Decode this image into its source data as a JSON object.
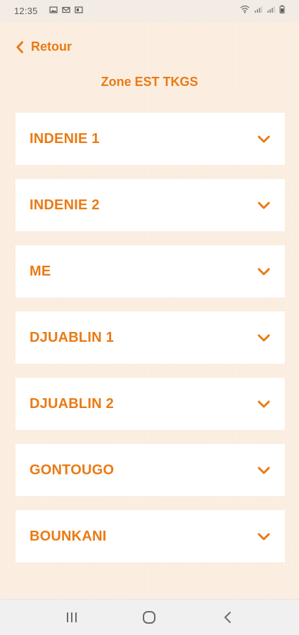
{
  "status_bar": {
    "time": "12:35",
    "left_icons": [
      "image-icon",
      "mail-icon",
      "media-icon"
    ],
    "right_icons": [
      "wifi-icon",
      "signal-icon",
      "signal-icon",
      "battery-icon"
    ]
  },
  "header": {
    "back_label": "Retour",
    "title": "Zone EST TKGS"
  },
  "zones": [
    {
      "label": "INDENIE 1"
    },
    {
      "label": "INDENIE 2"
    },
    {
      "label": "ME"
    },
    {
      "label": "DJUABLIN 1"
    },
    {
      "label": "DJUABLIN 2"
    },
    {
      "label": "GONTOUGO"
    },
    {
      "label": "BOUNKANI"
    }
  ],
  "colors": {
    "accent": "#ea7a14",
    "background": "#fbeee1",
    "card": "#ffffff"
  },
  "nav_bar": {
    "buttons": [
      "recent-apps-icon",
      "home-icon",
      "back-icon"
    ]
  }
}
